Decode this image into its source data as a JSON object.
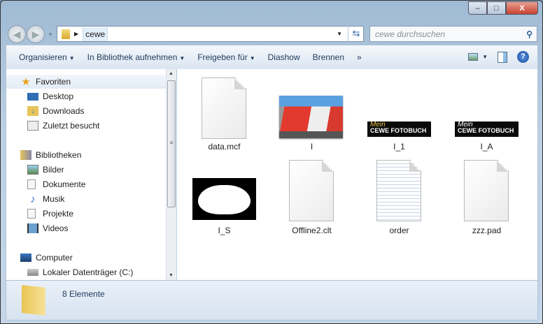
{
  "window": {
    "controls": {
      "minimize": "–",
      "maximize": "□",
      "close": "X"
    }
  },
  "address": {
    "crumb": "cewe",
    "search_placeholder": "cewe durchsuchen"
  },
  "toolbar": {
    "items": [
      "Organisieren",
      "In Bibliothek aufnehmen",
      "Freigeben für",
      "Diashow",
      "Brennen"
    ],
    "more": "»"
  },
  "sidebar": {
    "favorites": {
      "label": "Favoriten",
      "items": [
        "Desktop",
        "Downloads",
        "Zuletzt besucht"
      ]
    },
    "libraries": {
      "label": "Bibliotheken",
      "items": [
        "Bilder",
        "Dokumente",
        "Musik",
        "Projekte",
        "Videos"
      ]
    },
    "computer": {
      "label": "Computer",
      "items": [
        "Lokaler Datenträger (C:)"
      ]
    }
  },
  "files": [
    {
      "name": "data.mcf",
      "type": "document"
    },
    {
      "name": "I",
      "type": "photo"
    },
    {
      "name": "I_1",
      "type": "banner",
      "banner_top": "Mein",
      "banner_bottom": "CEWE FOTOBUCH"
    },
    {
      "name": "I_A",
      "type": "banner",
      "banner_top": "Mein",
      "banner_bottom": "CEWE FOTOBUCH"
    },
    {
      "name": "I_S",
      "type": "cloud"
    },
    {
      "name": "Offline2.clt",
      "type": "document"
    },
    {
      "name": "order",
      "type": "text"
    },
    {
      "name": "zzz.pad",
      "type": "document"
    }
  ],
  "status": {
    "count": "8 Elemente"
  }
}
